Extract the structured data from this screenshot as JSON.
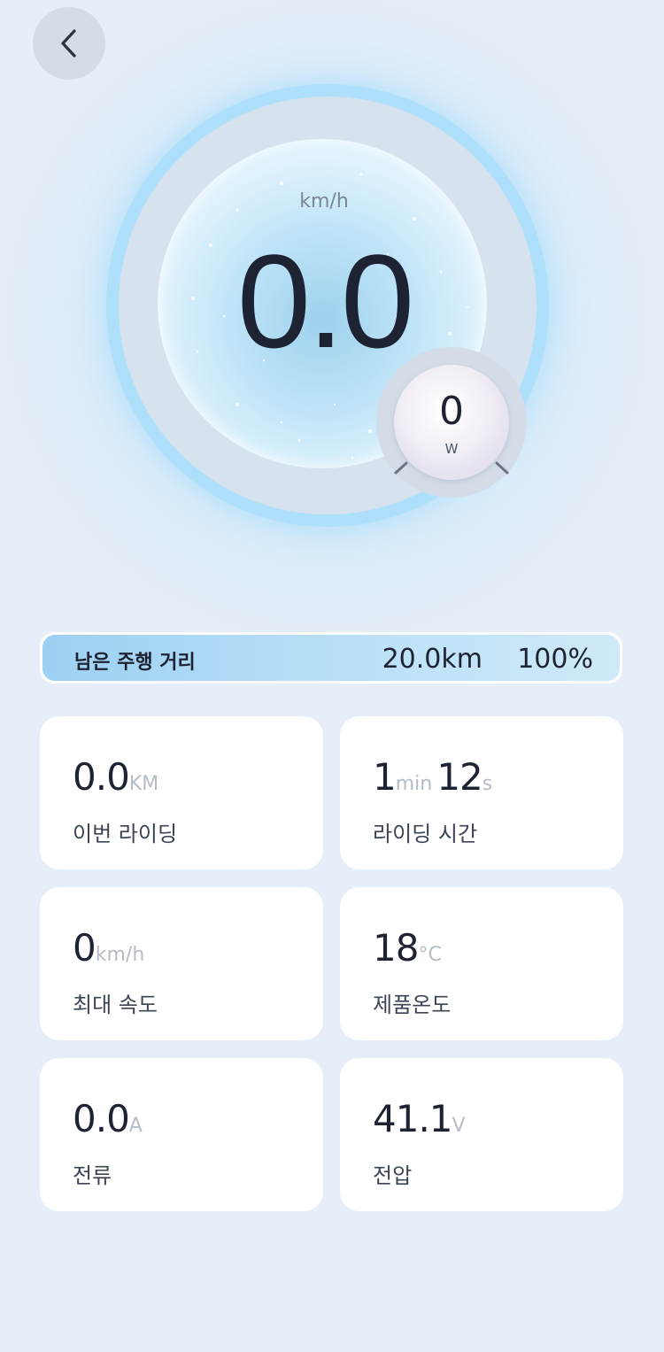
{
  "header": {
    "back_icon": "chevron-left-icon"
  },
  "speedometer": {
    "unit": "km/h",
    "value": "0.0"
  },
  "power": {
    "value": "0",
    "unit": "W"
  },
  "range": {
    "label": "남은 주행 거리",
    "distance": "20.0km",
    "percent": "100%",
    "battery_fraction": 1.0
  },
  "stats": [
    {
      "value": "0.0",
      "unit": "KM",
      "label": "이번 라이딩"
    },
    {
      "value_min": "1",
      "unit_min": "min",
      "value_sec": "12",
      "unit_sec": "s",
      "label": "라이딩 시간"
    },
    {
      "value": "0",
      "unit": "km/h",
      "label": "최대 속도"
    },
    {
      "value": "18",
      "unit": "°C",
      "label": "제품온도"
    },
    {
      "value": "0.0",
      "unit": "A",
      "label": "전류"
    },
    {
      "value": "41.1",
      "unit": "V",
      "label": "전압"
    }
  ],
  "colors": {
    "background": "#e6eef9",
    "ring": "#aee0fb",
    "range_fill": "#9dd0f3",
    "text_primary": "#1d2333",
    "unit_gray": "#b4bcc7"
  }
}
